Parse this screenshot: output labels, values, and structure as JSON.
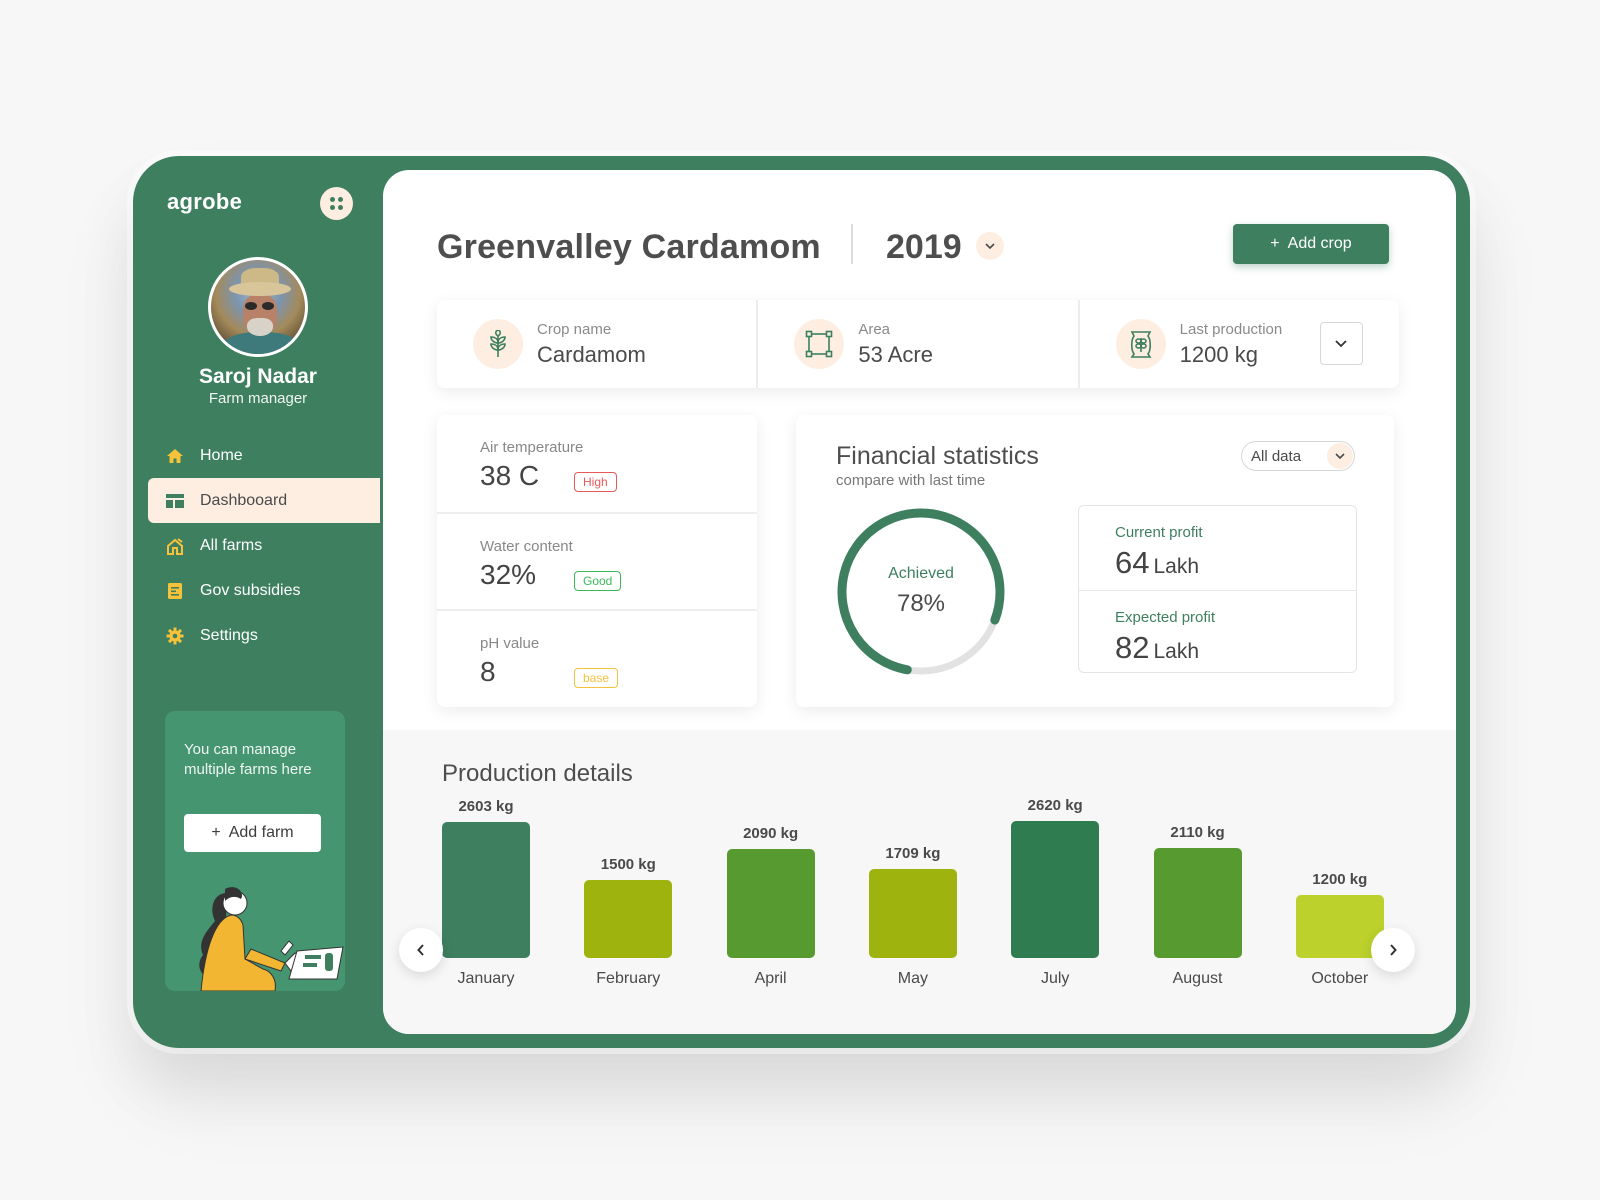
{
  "brand": {
    "name": "agrobe",
    "apps_icon": "grid-dots-icon"
  },
  "user": {
    "name": "Saroj Nadar",
    "role": "Farm manager"
  },
  "sidebar": {
    "items": [
      {
        "label": "Home",
        "icon": "home-icon",
        "active": false
      },
      {
        "label": "Dashbooard",
        "icon": "dashboard-icon",
        "active": true
      },
      {
        "label": "All farms",
        "icon": "farm-icon",
        "active": false
      },
      {
        "label": "Gov subsidies",
        "icon": "document-icon",
        "active": false
      },
      {
        "label": "Settings",
        "icon": "gear-icon",
        "active": false
      }
    ],
    "promo": {
      "text": "You can manage multiple farms here",
      "button_label": "Add farm",
      "button_icon": "plus-icon"
    }
  },
  "header": {
    "title": "Greenvalley Cardamom",
    "year": "2019",
    "year_dropdown_icon": "chevron-down-icon",
    "add_crop_label": "Add crop"
  },
  "info": [
    {
      "label": "Crop name",
      "value": "Cardamom",
      "icon": "wheat-icon"
    },
    {
      "label": "Area",
      "value": "53 Acre",
      "icon": "area-square-icon"
    },
    {
      "label": "Last production",
      "value": "1200 kg",
      "icon": "grain-sack-icon"
    }
  ],
  "metrics": [
    {
      "label": "Air temperature",
      "value": "38 C",
      "badge": "High",
      "badge_color": "#e85a5a"
    },
    {
      "label": "Water content",
      "value": "32%",
      "badge": "Good",
      "badge_color": "#3cb85a"
    },
    {
      "label": "pH value",
      "value": "8",
      "badge": "base",
      "badge_color": "#f2c23a"
    }
  ],
  "financial": {
    "title": "Financial statistics",
    "subtitle": "compare with last time",
    "filter": "All data",
    "achieved_label": "Achieved",
    "achieved_value": "78%",
    "achieved_fraction": 0.78,
    "current_profit_label": "Current profit",
    "current_profit_value": "64",
    "current_profit_unit": "Lakh",
    "expected_profit_label": "Expected profit",
    "expected_profit_value": "82",
    "expected_profit_unit": "Lakh"
  },
  "colors": {
    "brand": "#3d7f5f",
    "accent_soft": "#fdeee1",
    "gauge_track": "#e2e2e2"
  },
  "production": {
    "title": "Production details",
    "prev_icon": "chevron-left-icon",
    "next_icon": "chevron-right-icon"
  },
  "chart_data": {
    "type": "bar",
    "title": "Production details",
    "categories": [
      "January",
      "February",
      "April",
      "May",
      "July",
      "August",
      "October"
    ],
    "values": [
      2603,
      1500,
      2090,
      1709,
      2620,
      2110,
      1200
    ],
    "value_labels": [
      "2603 kg",
      "1500 kg",
      "2090 kg",
      "1709 kg",
      "2620 kg",
      "2110 kg",
      "1200 kg"
    ],
    "bar_colors": [
      "#3d7f5f",
      "#9fb30f",
      "#579a30",
      "#9fb30f",
      "#2e7c50",
      "#579a30",
      "#bcd12c"
    ],
    "unit": "kg",
    "xlabel": "",
    "ylabel": "",
    "grid": false
  }
}
